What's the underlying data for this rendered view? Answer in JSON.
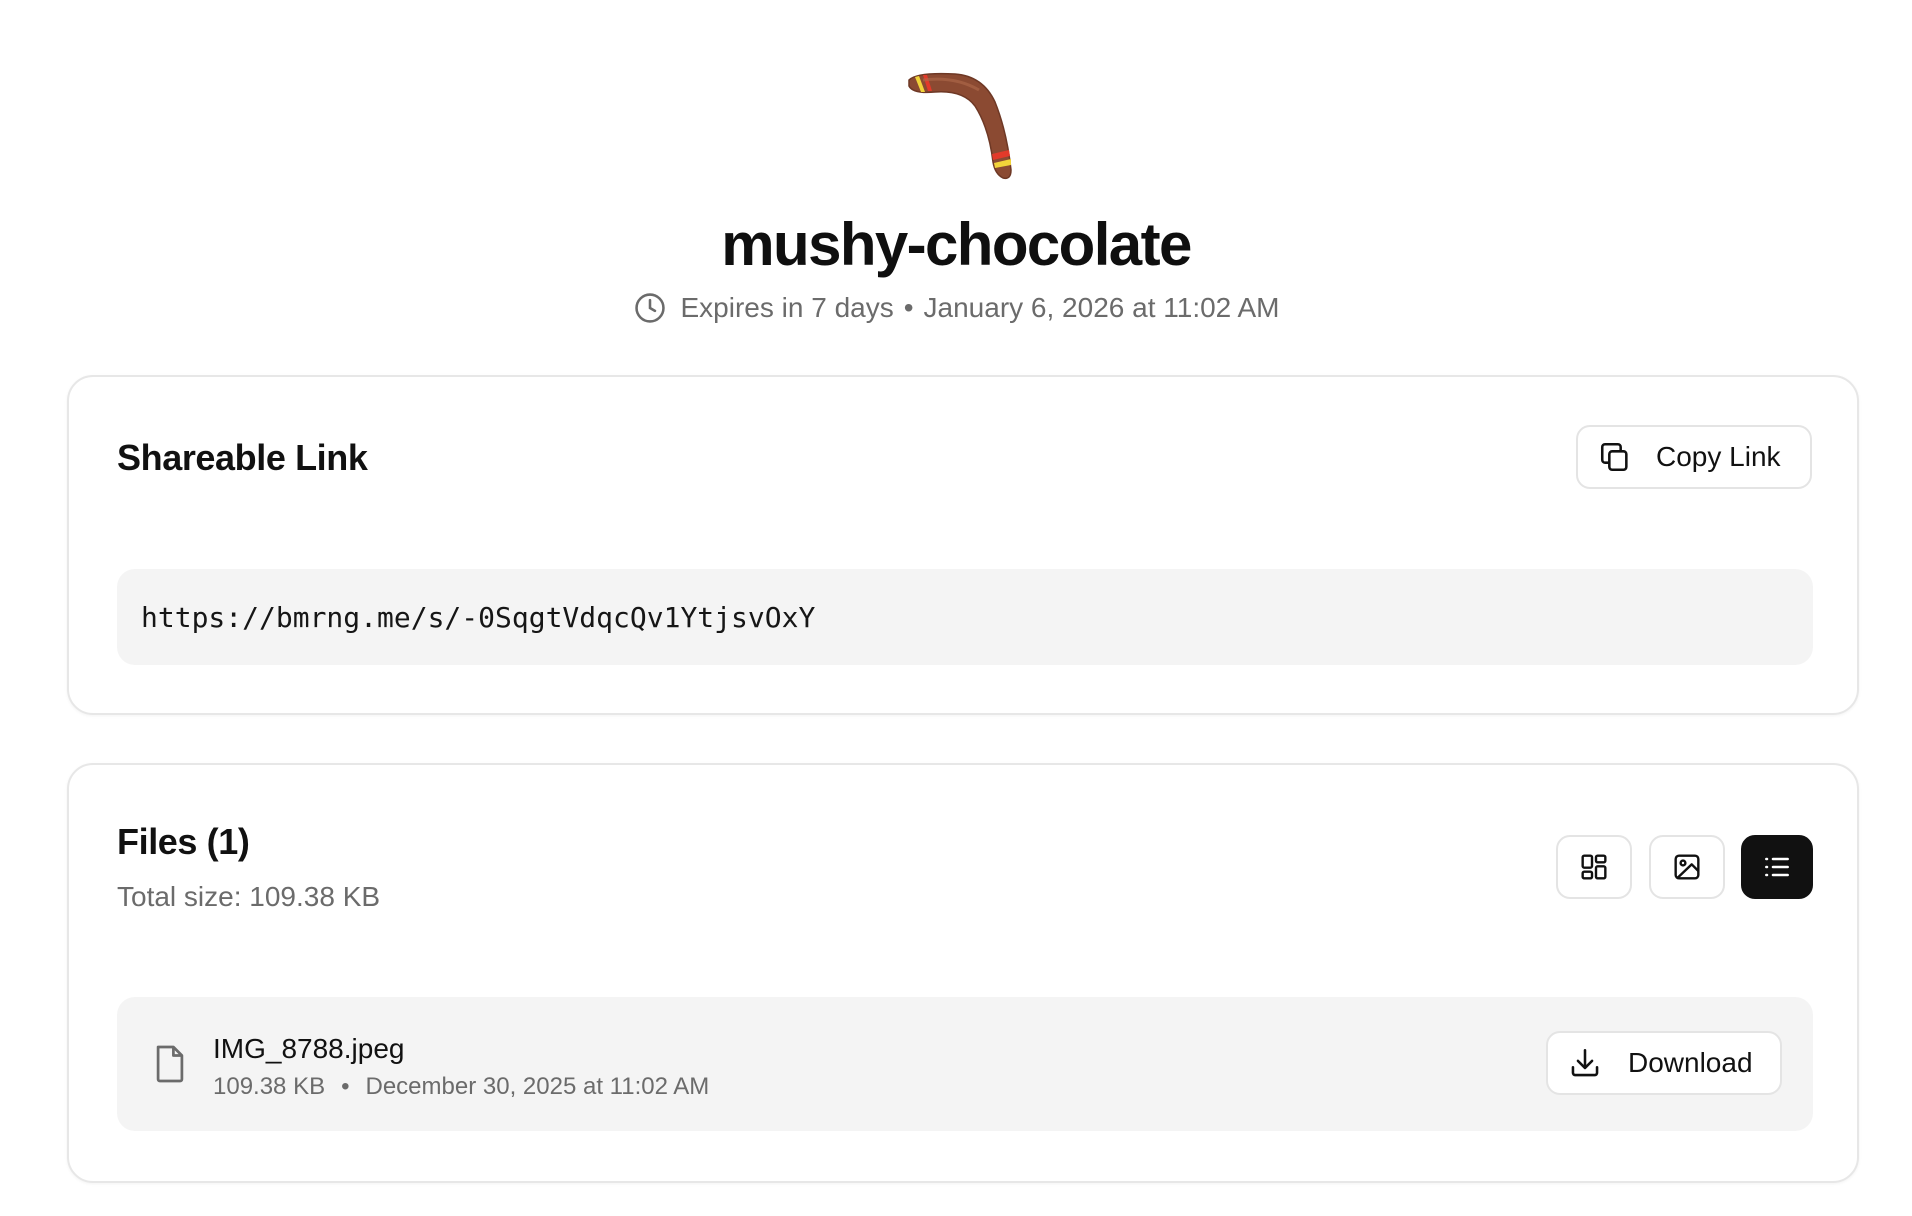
{
  "header": {
    "title": "mushy-chocolate",
    "expires_text": "Expires in 7 days",
    "separator": "•",
    "expires_at": "January 6, 2026 at 11:02 AM"
  },
  "share": {
    "title": "Shareable Link",
    "copy_label": "Copy Link",
    "url": "https://bmrng.me/s/-0SqgtVdqcQv1YtjsvOxY"
  },
  "files": {
    "title": "Files (1)",
    "total_size": "Total size: 109.38 KB",
    "view_modes": [
      "grid-icon",
      "image-icon",
      "list-icon"
    ],
    "active_view": "list",
    "items": [
      {
        "name": "IMG_8788.jpeg",
        "size": "109.38 KB",
        "separator": "•",
        "date": "December 30, 2025 at 11:02 AM",
        "download_label": "Download"
      }
    ]
  },
  "colors": {
    "boomerang_body": "#8b4a32",
    "boomerang_stripe_red": "#e23a2a",
    "boomerang_stripe_yellow": "#f2d43a",
    "active_toggle": "#111111",
    "muted_text": "#6b6b6b",
    "surface": "#f4f4f4"
  }
}
